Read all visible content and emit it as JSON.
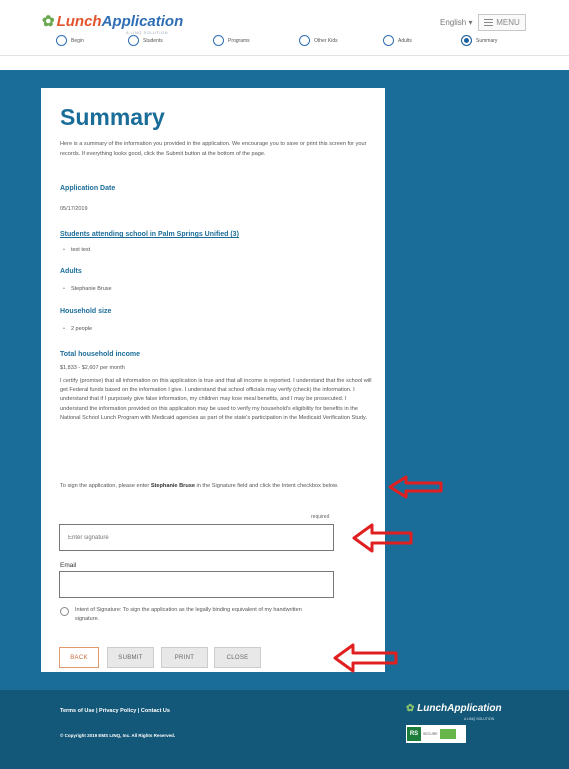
{
  "header": {
    "logo_text_a": "Lunch",
    "logo_text_b": "Application",
    "logo_sub": "A LINQ SOLUTION",
    "language": "English",
    "language_caret": "▾",
    "menu_label": "MENU"
  },
  "steps": [
    {
      "label": "Begin"
    },
    {
      "label": "Students"
    },
    {
      "label": "Programs"
    },
    {
      "label": "Other Kids"
    },
    {
      "label": "Adults"
    },
    {
      "label": "Summary"
    }
  ],
  "summary": {
    "title": "Summary",
    "intro": "Here is a summary of the information you provided in the application. We encourage you to save or print this screen for your records. If everything looks good, click the Submit button at the bottom of the page.",
    "app_date_label": "Application Date",
    "app_date_value": "05/17/2019",
    "students_label": "Students attending school in Palm Springs Unified (3)",
    "students_item": "test test",
    "adults_label": "Adults",
    "adults_item": "Stephanie Bruse",
    "household_label": "Household size",
    "household_item": "2 people",
    "income_label": "Total household income",
    "income_value": "$1,833 - $2,607 per month",
    "certify": "I certify (promise) that all information on this application is true and that all income is reported. I understand that the school will get Federal funds based on the information I give. I understand that school officials may verify (check) the information. I understand that if I purposely give false information, my children may lose meal benefits, and I may be prosecuted. I understand the information provided on this application may be used to verify my household's eligibility for benefits in the National School Lunch Program with Medicaid agencies as part of the state's participation in the Medicaid Verification Study.",
    "sign_instr_a": "To sign the application, please enter ",
    "sign_instr_name": "Stephanie Bruse",
    "sign_instr_b": " in the Signature field and click the Intent checkbox below.",
    "required": "required",
    "signature_placeholder": "Enter signature",
    "email_label": "Email",
    "intent_label": "Intent of Signature: To sign the application as the legally binding equivalent of my handwritten signature.",
    "buttons": {
      "back": "BACK",
      "submit": "SUBMIT",
      "print": "PRINT",
      "close": "CLOSE"
    }
  },
  "footer": {
    "links": "Terms of Use | Privacy Policy | Contact Us",
    "copyright": "© Copyright 2019 EMS LINQ, Inc. All Rights Reserved.",
    "logo": "LunchApplication",
    "logo_sub": "A LINQ SOLUTION",
    "badge_rs": "RS",
    "badge_text": "SECURE"
  },
  "colors": {
    "brand_blue": "#1b6d99",
    "footer_blue": "#135878",
    "arrow_red": "#e02020",
    "back_orange": "#c46a3c"
  },
  "icons": [
    "leaf-logo-icon",
    "hamburger-icon",
    "step-circle-icon",
    "red-arrow-icon",
    "secure-badge-icon"
  ]
}
